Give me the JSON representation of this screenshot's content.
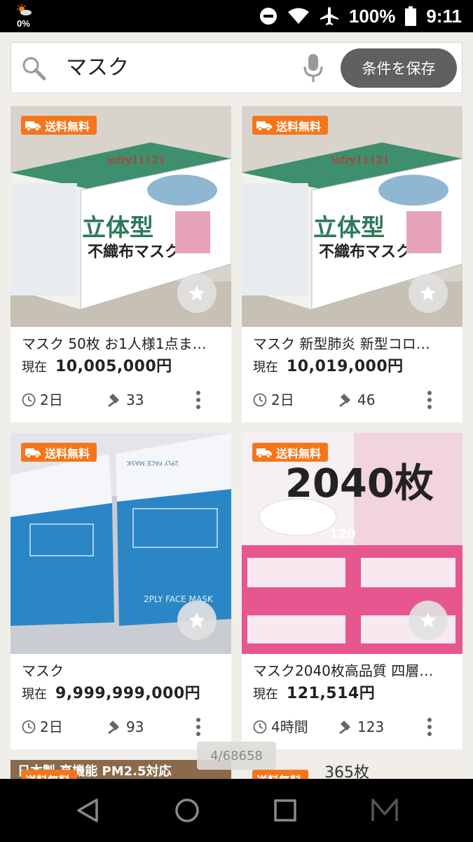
{
  "status_bar": {
    "weather_percent": "0%",
    "battery": "100%",
    "time": "9:11"
  },
  "search": {
    "query": "マスク",
    "save_button": "条件を保存"
  },
  "colors": {
    "badge": "#f5761a",
    "save_button": "#606060",
    "background": "#efeee9"
  },
  "items": [
    {
      "badge": "送料無料",
      "image_text": "iofry11121",
      "title": "マスク 50枚 お1人様1点ま…",
      "price_label": "現在",
      "price": "10,005,000円",
      "time_left": "2日",
      "bids": "33"
    },
    {
      "badge": "送料無料",
      "image_text": "iofry11121",
      "title": "マスク 新型肺炎 新型コロ…",
      "price_label": "現在",
      "price": "10,019,000円",
      "time_left": "2日",
      "bids": "46"
    },
    {
      "badge": "送料無料",
      "image_text": "2PLY FACE MASK",
      "title": "マスク",
      "price_label": "現在",
      "price": "9,999,999,000円",
      "time_left": "2日",
      "bids": "93"
    },
    {
      "badge": "送料無料",
      "image_text": "2040枚",
      "title": "マスク2040枚高品質 四層…",
      "price_label": "現在",
      "price": "121,514円",
      "time_left": "4時間",
      "bids": "123"
    }
  ],
  "partial_items": [
    {
      "badge": "送料無料",
      "image_text": "日本製  高機能 PM2.5対応"
    },
    {
      "badge": "送料無料",
      "image_text": "365枚"
    }
  ],
  "pager": "4/68658"
}
